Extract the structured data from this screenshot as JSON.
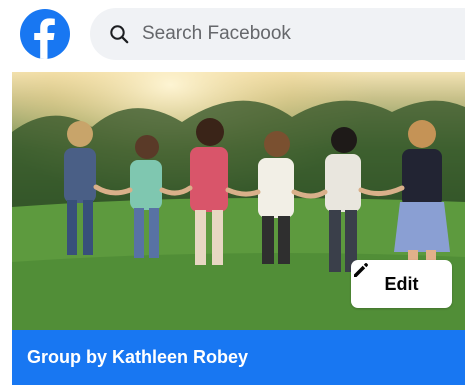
{
  "header": {
    "logo_icon": "facebook-logo-icon",
    "search_icon": "search-icon",
    "search_placeholder": "Search Facebook"
  },
  "cover": {
    "edit_icon": "pencil-icon",
    "edit_label": "Edit"
  },
  "group": {
    "label": "Group by Kathleen Robey"
  },
  "colors": {
    "brand": "#1877f2",
    "search_bg": "#f0f2f5",
    "text_secondary": "#65676b"
  }
}
